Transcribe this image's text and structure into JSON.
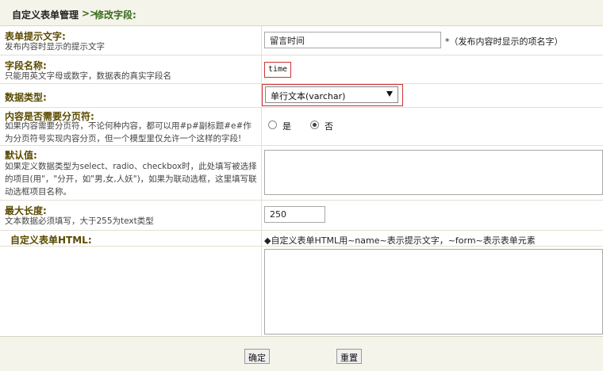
{
  "breadcrumb": {
    "parent": "自定义表单管理",
    "separator": ">>",
    "current": "修改字段:"
  },
  "fields": {
    "prompt": {
      "label": "表单提示文字:",
      "help": "发布内容时显示的提示文字",
      "value": "留言时间",
      "note": "*（发布内容时显示的项名字）"
    },
    "name": {
      "label": "字段名称:",
      "help": "只能用英文字母或数字，数据表的真实字段名",
      "value": "time"
    },
    "type": {
      "label": "数据类型:",
      "selected": "单行文本(varchar)"
    },
    "paging": {
      "label": "内容是否需要分页符:",
      "help": "如果内容需要分页符，不论何种内容，都可以用#p#副标题#e#作为分页符号实现内容分页，但一个模型里仅允许一个这样的字段!",
      "option_yes": "是",
      "option_no": "否"
    },
    "default": {
      "label": "默认值:",
      "help": "如果定义数据类型为select、radio、checkbox时，此处填写被选择的项目(用\"，\"分开，如\"男,女,人妖\")，如果为联动选框，这里填写联动选框项目名称。"
    },
    "maxlen": {
      "label": "最大长度:",
      "help": "文本数据必须填写，大于255为text类型",
      "value": "250"
    },
    "html": {
      "label": "自定义表单HTML:",
      "note": "◆自定义表单HTML用~name~表示提示文字，~form~表示表单元素"
    }
  },
  "buttons": {
    "ok": "确定",
    "reset": "重置"
  }
}
